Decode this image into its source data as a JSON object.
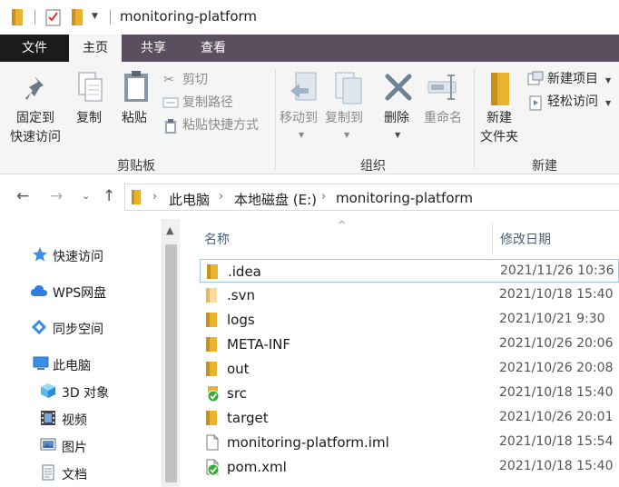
{
  "window": {
    "title": "monitoring-platform"
  },
  "ribbon_tabs": [
    "文件",
    "主页",
    "共享",
    "查看"
  ],
  "ribbon": {
    "clipboard": {
      "pin_line1": "固定到",
      "pin_line2": "快速访问",
      "copy": "复制",
      "paste": "粘贴",
      "cut": "剪切",
      "copy_path": "复制路径",
      "paste_shortcut": "粘贴快捷方式",
      "label": "剪贴板"
    },
    "organize": {
      "move_to": "移动到",
      "copy_to": "复制到",
      "delete": "删除",
      "rename": "重命名",
      "label": "组织"
    },
    "new": {
      "new_folder_line1": "新建",
      "new_folder_line2": "文件夹",
      "new_item": "新建项目",
      "easy_access": "轻松访问",
      "label": "新建"
    }
  },
  "address": {
    "crumbs": [
      "此电脑",
      "本地磁盘 (E:)",
      "monitoring-platform"
    ]
  },
  "nav_pane": {
    "items": [
      {
        "label": "快速访问",
        "icon": "star-icon"
      },
      {
        "label": "WPS网盘",
        "icon": "cloud-icon"
      },
      {
        "label": "同步空间",
        "icon": "sync-icon"
      },
      {
        "label": "此电脑",
        "icon": "computer-icon"
      },
      {
        "label": "3D 对象",
        "icon": "cube-icon"
      },
      {
        "label": "视频",
        "icon": "video-icon"
      },
      {
        "label": "图片",
        "icon": "picture-icon"
      },
      {
        "label": "文档",
        "icon": "document-icon"
      }
    ]
  },
  "columns": {
    "name": "名称",
    "modified": "修改日期"
  },
  "files": [
    {
      "name": ".idea",
      "date": "2021/11/26 10:36",
      "type": "folder"
    },
    {
      "name": ".svn",
      "date": "2021/10/18 15:40",
      "type": "folder-hidden"
    },
    {
      "name": "logs",
      "date": "2021/10/21 9:30",
      "type": "folder"
    },
    {
      "name": "META-INF",
      "date": "2021/10/26 20:06",
      "type": "folder"
    },
    {
      "name": "out",
      "date": "2021/10/26 20:08",
      "type": "folder"
    },
    {
      "name": "src",
      "date": "2021/10/18 15:40",
      "type": "folder-synced"
    },
    {
      "name": "target",
      "date": "2021/10/26 20:01",
      "type": "folder"
    },
    {
      "name": "monitoring-platform.iml",
      "date": "2021/10/18 15:54",
      "type": "file"
    },
    {
      "name": "pom.xml",
      "date": "2021/10/18 15:40",
      "type": "file-synced"
    }
  ],
  "colors": {
    "folder": "#e8b430",
    "accent": "#5a4f5f",
    "sync_ok": "#3aa935"
  }
}
